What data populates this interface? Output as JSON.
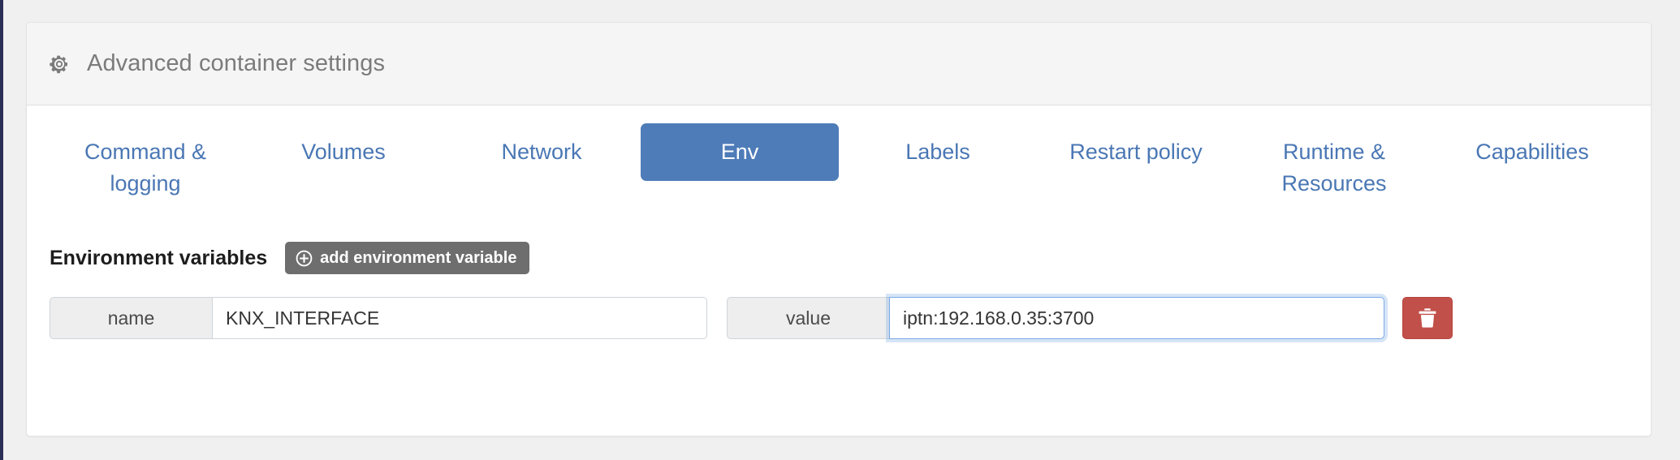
{
  "theme": {
    "accent_blue": "#4a77b4",
    "active_tab_bg": "#4e7cb8",
    "add_button_bg": "#6e6e6e",
    "delete_button_bg": "#c2504a",
    "card_header_bg": "#f5f5f5",
    "page_bg": "#f0f0f0",
    "rail_bg": "#2b2f56",
    "focus_border": "#7aaae8",
    "addon_bg": "#eeeeee"
  },
  "card": {
    "header": {
      "icon": "gear-icon",
      "title": "Advanced container settings"
    }
  },
  "tabs": [
    {
      "label": "Command & logging",
      "active": false
    },
    {
      "label": "Volumes",
      "active": false
    },
    {
      "label": "Network",
      "active": false
    },
    {
      "label": "Env",
      "active": true
    },
    {
      "label": "Labels",
      "active": false
    },
    {
      "label": "Restart policy",
      "active": false
    },
    {
      "label": "Runtime & Resources",
      "active": false
    },
    {
      "label": "Capabilities",
      "active": false
    }
  ],
  "env_section": {
    "title": "Environment variables",
    "add_button": {
      "label": "add environment variable",
      "icon": "plus-circle-icon"
    },
    "rows": [
      {
        "name_addon": "name",
        "name_value": "KNX_INTERFACE",
        "name_placeholder": "e.g. FOO",
        "value_addon": "value",
        "value_value": "iptn:192.168.0.35:3700",
        "value_placeholder": "e.g. bar",
        "value_focused": true,
        "delete_icon": "trash-icon"
      }
    ]
  }
}
